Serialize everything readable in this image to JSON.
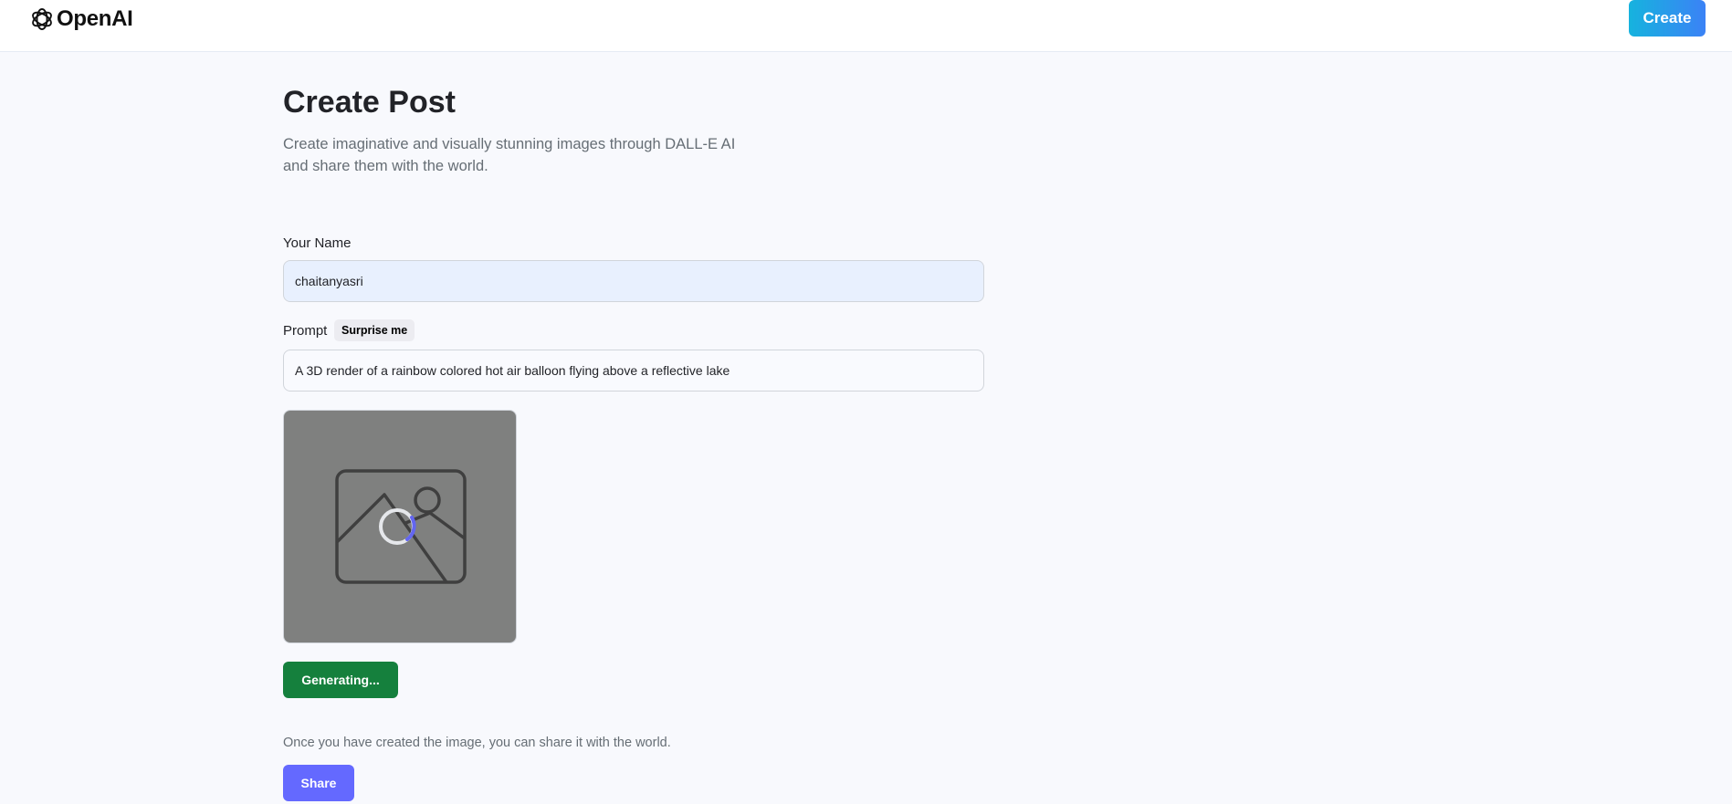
{
  "header": {
    "logo_text": "OpenAI",
    "create_label": "Create"
  },
  "page": {
    "title": "Create Post",
    "subtitle": "Create imaginative and visually stunning images through DALL-E AI and share them with the world."
  },
  "form": {
    "name_label": "Your Name",
    "name_value": "chaitanyasri",
    "prompt_label": "Prompt",
    "surprise_label": "Surprise me",
    "prompt_value": "A 3D render of a rainbow colored hot air balloon flying above a reflective lake",
    "generate_label": "Generating...",
    "share_text": "Once you have created the image, you can share it with the world.",
    "share_label": "Share"
  },
  "colors": {
    "generate_button": "#15803d",
    "share_button": "#6469ff",
    "create_button_start": "#16b3de",
    "create_button_end": "#3b82f6",
    "spinner_accent": "#6366f1",
    "name_input_bg": "#e8f0fe"
  },
  "icons": {
    "logo": "openai-logo-icon",
    "preview": "image-placeholder-icon",
    "loader": "loading-spinner-icon"
  }
}
